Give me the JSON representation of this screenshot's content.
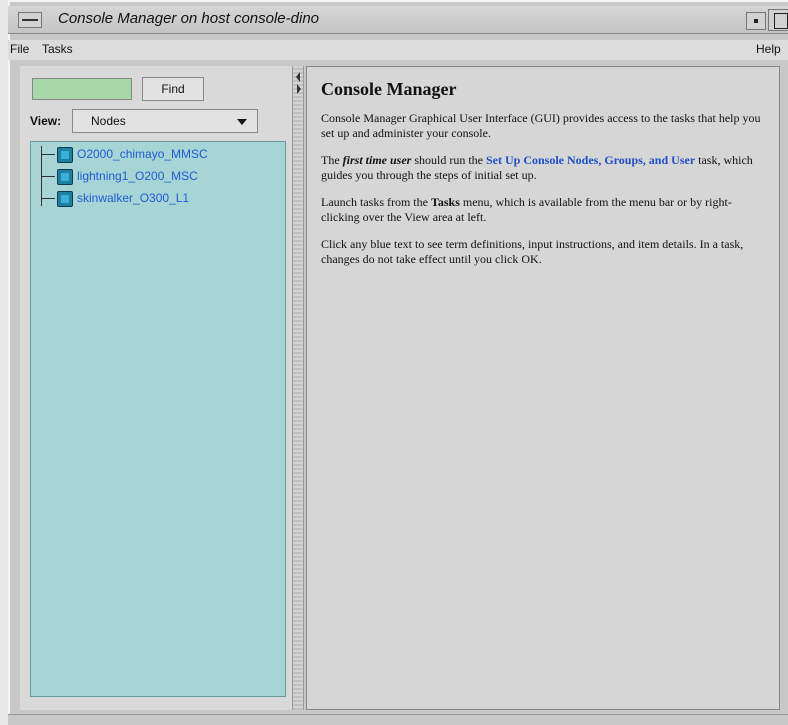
{
  "window": {
    "title": "Console Manager on host console-dino"
  },
  "menubar": {
    "file": "File",
    "tasks": "Tasks",
    "help": "Help"
  },
  "find": {
    "input_value": "",
    "button_label": "Find"
  },
  "view": {
    "label": "View:",
    "selected": "Nodes"
  },
  "tree": {
    "nodes": [
      {
        "label": "O2000_chimayo_MMSC"
      },
      {
        "label": "lightning1_O200_MSC"
      },
      {
        "label": "skinwalker_O300_L1"
      }
    ]
  },
  "content": {
    "title": "Console Manager",
    "para1": "Console Manager Graphical User Interface (GUI) provides access to the tasks that help you set up and administer your console.",
    "para2_pre": "The ",
    "para2_em": "first time user",
    "para2_mid": " should run the ",
    "para2_link": "Set Up Console Nodes, Groups, and User",
    "para2_post": " task, which guides you through the steps of initial set up.",
    "para3_pre": "Launch tasks from the ",
    "para3_bold": "Tasks",
    "para3_post": " menu, which is available from the menu bar or by right-clicking over the View area at left.",
    "para4": "Click any blue text to see term definitions, input instructions, and item details. In a task, changes do not take effect until you click OK."
  },
  "colors": {
    "tree_background": "#a7d5d5",
    "find_input": "#a8d8a8",
    "link": "#1f4fc8",
    "tree_text": "#1f5bd3"
  }
}
